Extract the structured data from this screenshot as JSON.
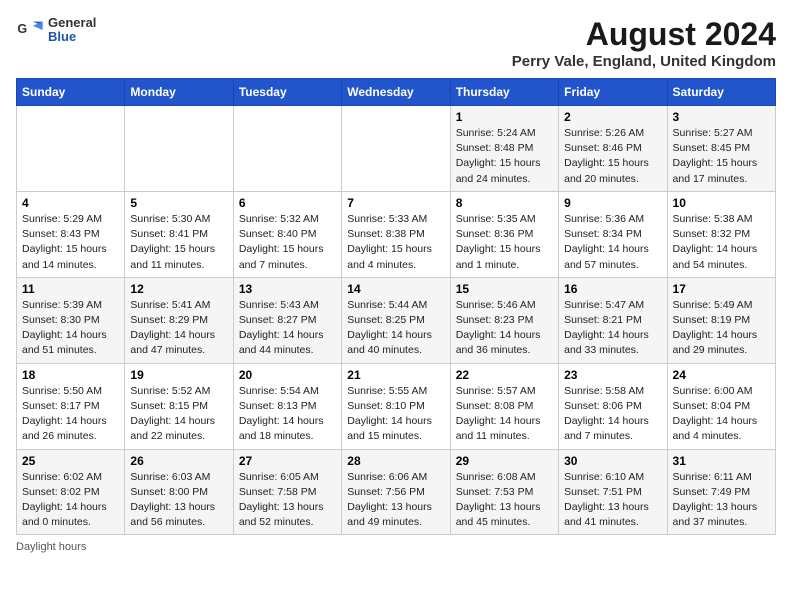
{
  "logo": {
    "general": "General",
    "blue": "Blue"
  },
  "header": {
    "title": "August 2024",
    "subtitle": "Perry Vale, England, United Kingdom"
  },
  "columns": [
    "Sunday",
    "Monday",
    "Tuesday",
    "Wednesday",
    "Thursday",
    "Friday",
    "Saturday"
  ],
  "rows": [
    [
      {
        "empty": true
      },
      {
        "empty": true
      },
      {
        "empty": true
      },
      {
        "empty": true
      },
      {
        "day": 1,
        "sunrise": "5:24 AM",
        "sunset": "8:48 PM",
        "daylight": "15 hours and 24 minutes."
      },
      {
        "day": 2,
        "sunrise": "5:26 AM",
        "sunset": "8:46 PM",
        "daylight": "15 hours and 20 minutes."
      },
      {
        "day": 3,
        "sunrise": "5:27 AM",
        "sunset": "8:45 PM",
        "daylight": "15 hours and 17 minutes."
      }
    ],
    [
      {
        "day": 4,
        "sunrise": "5:29 AM",
        "sunset": "8:43 PM",
        "daylight": "15 hours and 14 minutes."
      },
      {
        "day": 5,
        "sunrise": "5:30 AM",
        "sunset": "8:41 PM",
        "daylight": "15 hours and 11 minutes."
      },
      {
        "day": 6,
        "sunrise": "5:32 AM",
        "sunset": "8:40 PM",
        "daylight": "15 hours and 7 minutes."
      },
      {
        "day": 7,
        "sunrise": "5:33 AM",
        "sunset": "8:38 PM",
        "daylight": "15 hours and 4 minutes."
      },
      {
        "day": 8,
        "sunrise": "5:35 AM",
        "sunset": "8:36 PM",
        "daylight": "15 hours and 1 minute."
      },
      {
        "day": 9,
        "sunrise": "5:36 AM",
        "sunset": "8:34 PM",
        "daylight": "14 hours and 57 minutes."
      },
      {
        "day": 10,
        "sunrise": "5:38 AM",
        "sunset": "8:32 PM",
        "daylight": "14 hours and 54 minutes."
      }
    ],
    [
      {
        "day": 11,
        "sunrise": "5:39 AM",
        "sunset": "8:30 PM",
        "daylight": "14 hours and 51 minutes."
      },
      {
        "day": 12,
        "sunrise": "5:41 AM",
        "sunset": "8:29 PM",
        "daylight": "14 hours and 47 minutes."
      },
      {
        "day": 13,
        "sunrise": "5:43 AM",
        "sunset": "8:27 PM",
        "daylight": "14 hours and 44 minutes."
      },
      {
        "day": 14,
        "sunrise": "5:44 AM",
        "sunset": "8:25 PM",
        "daylight": "14 hours and 40 minutes."
      },
      {
        "day": 15,
        "sunrise": "5:46 AM",
        "sunset": "8:23 PM",
        "daylight": "14 hours and 36 minutes."
      },
      {
        "day": 16,
        "sunrise": "5:47 AM",
        "sunset": "8:21 PM",
        "daylight": "14 hours and 33 minutes."
      },
      {
        "day": 17,
        "sunrise": "5:49 AM",
        "sunset": "8:19 PM",
        "daylight": "14 hours and 29 minutes."
      }
    ],
    [
      {
        "day": 18,
        "sunrise": "5:50 AM",
        "sunset": "8:17 PM",
        "daylight": "14 hours and 26 minutes."
      },
      {
        "day": 19,
        "sunrise": "5:52 AM",
        "sunset": "8:15 PM",
        "daylight": "14 hours and 22 minutes."
      },
      {
        "day": 20,
        "sunrise": "5:54 AM",
        "sunset": "8:13 PM",
        "daylight": "14 hours and 18 minutes."
      },
      {
        "day": 21,
        "sunrise": "5:55 AM",
        "sunset": "8:10 PM",
        "daylight": "14 hours and 15 minutes."
      },
      {
        "day": 22,
        "sunrise": "5:57 AM",
        "sunset": "8:08 PM",
        "daylight": "14 hours and 11 minutes."
      },
      {
        "day": 23,
        "sunrise": "5:58 AM",
        "sunset": "8:06 PM",
        "daylight": "14 hours and 7 minutes."
      },
      {
        "day": 24,
        "sunrise": "6:00 AM",
        "sunset": "8:04 PM",
        "daylight": "14 hours and 4 minutes."
      }
    ],
    [
      {
        "day": 25,
        "sunrise": "6:02 AM",
        "sunset": "8:02 PM",
        "daylight": "14 hours and 0 minutes."
      },
      {
        "day": 26,
        "sunrise": "6:03 AM",
        "sunset": "8:00 PM",
        "daylight": "13 hours and 56 minutes."
      },
      {
        "day": 27,
        "sunrise": "6:05 AM",
        "sunset": "7:58 PM",
        "daylight": "13 hours and 52 minutes."
      },
      {
        "day": 28,
        "sunrise": "6:06 AM",
        "sunset": "7:56 PM",
        "daylight": "13 hours and 49 minutes."
      },
      {
        "day": 29,
        "sunrise": "6:08 AM",
        "sunset": "7:53 PM",
        "daylight": "13 hours and 45 minutes."
      },
      {
        "day": 30,
        "sunrise": "6:10 AM",
        "sunset": "7:51 PM",
        "daylight": "13 hours and 41 minutes."
      },
      {
        "day": 31,
        "sunrise": "6:11 AM",
        "sunset": "7:49 PM",
        "daylight": "13 hours and 37 minutes."
      }
    ]
  ],
  "footer": {
    "note": "Daylight hours"
  }
}
